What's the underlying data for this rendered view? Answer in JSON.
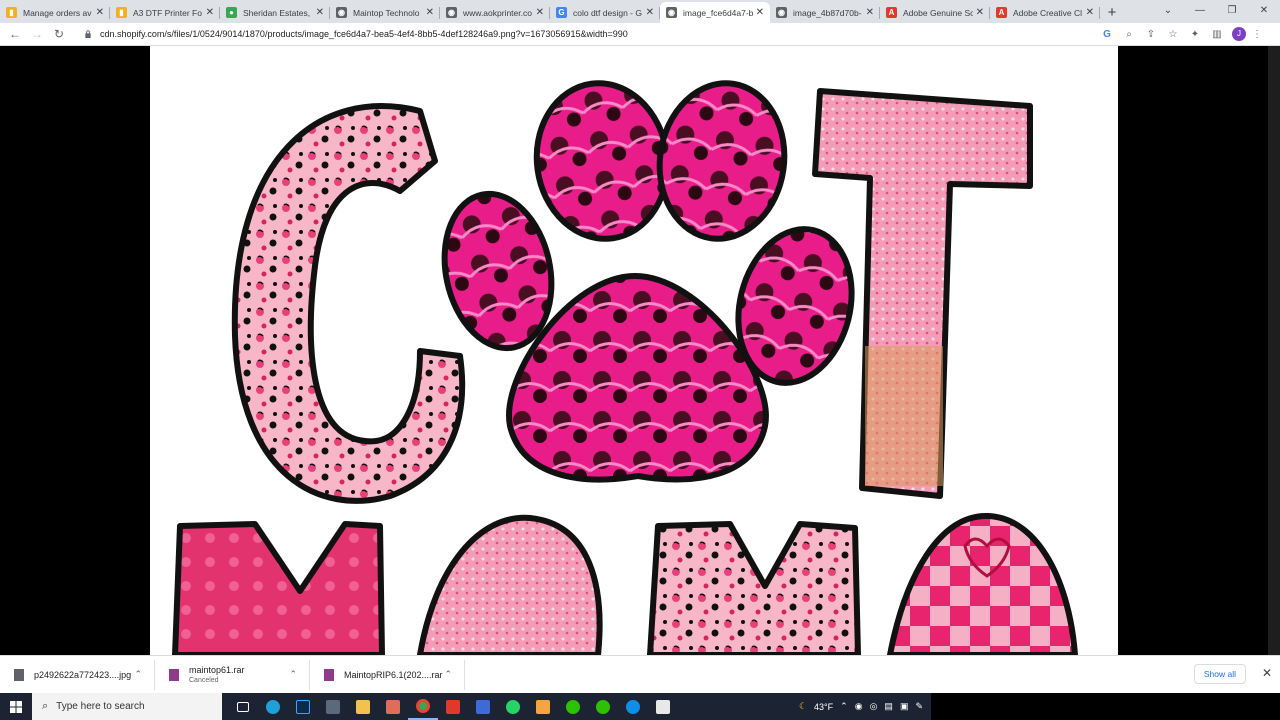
{
  "tabs": [
    {
      "title": "Manage orders av",
      "fav_color": "#f2b01e",
      "fav_glyph": "▮"
    },
    {
      "title": "A3 DTF Printer Fo",
      "fav_color": "#f2b01e",
      "fav_glyph": "▮"
    },
    {
      "title": "Sheridan Estates,",
      "fav_color": "#34a853",
      "fav_glyph": "●"
    },
    {
      "title": "Maintop Technolo",
      "fav_color": "#5f6368",
      "fav_glyph": "◉"
    },
    {
      "title": "www.aokprinter.co",
      "fav_color": "#5f6368",
      "fav_glyph": "◉"
    },
    {
      "title": "colo dtf design - G",
      "fav_color": "#4285f4",
      "fav_glyph": "G"
    },
    {
      "title": "image_fce6d4a7-b",
      "fav_color": "#5f6368",
      "fav_glyph": "◉",
      "active": true
    },
    {
      "title": "image_4b87d70b-",
      "fav_color": "#5f6368",
      "fav_glyph": "◉"
    },
    {
      "title": "Adobe Genuine So",
      "fav_color": "#e8372b",
      "fav_glyph": "A"
    },
    {
      "title": "Adobe Creative Cl",
      "fav_color": "#e8372b",
      "fav_glyph": "A"
    }
  ],
  "address": {
    "url": "cdn.shopify.com/s/files/1/0524/9014/1870/products/image_fce6d4a7-bea5-4ef4-8bb5-4def128246a9.png?v=1673056915&width=990"
  },
  "profile_initial": "J",
  "downloads": [
    {
      "name": "p2492622a772423....jpg",
      "status": ""
    },
    {
      "name": "maintop61.rar",
      "status": "Canceled"
    },
    {
      "name": "MaintopRIP6.1(202....rar",
      "status": ""
    }
  ],
  "show_all_label": "Show all",
  "taskbar": {
    "search_placeholder": "Type here to search",
    "weather": "43°F"
  }
}
